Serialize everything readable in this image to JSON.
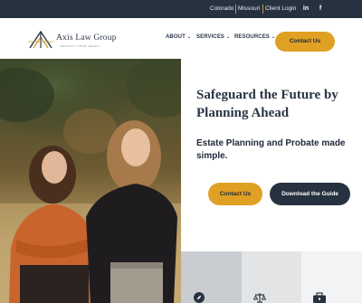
{
  "topbar": {
    "links": [
      "Colorado",
      "Missouri",
      "Client Login"
    ],
    "social": {
      "linkedin": "in",
      "facebook": "f"
    },
    "accent_color": "#c99a3b",
    "background": "#273241"
  },
  "logo": {
    "name": "Axis Law Group",
    "tagline": "PROTECT YOUR LEGACY"
  },
  "nav": {
    "items": [
      "ABOUT",
      "SERVICES",
      "RESOURCES"
    ],
    "cta": "Contact Us"
  },
  "hero": {
    "headline_line1": "Safeguard the Future by",
    "headline_line2": "Planning Ahead",
    "subheadline": "Estate Planning and Probate made simple.",
    "primary_button": "Contact Us",
    "secondary_button": "Download the Guide"
  },
  "tiles": {
    "icons": [
      "compass-icon",
      "scales-icon",
      "briefcase-icon"
    ]
  },
  "colors": {
    "gold": "#dfa023",
    "navy": "#273241"
  }
}
